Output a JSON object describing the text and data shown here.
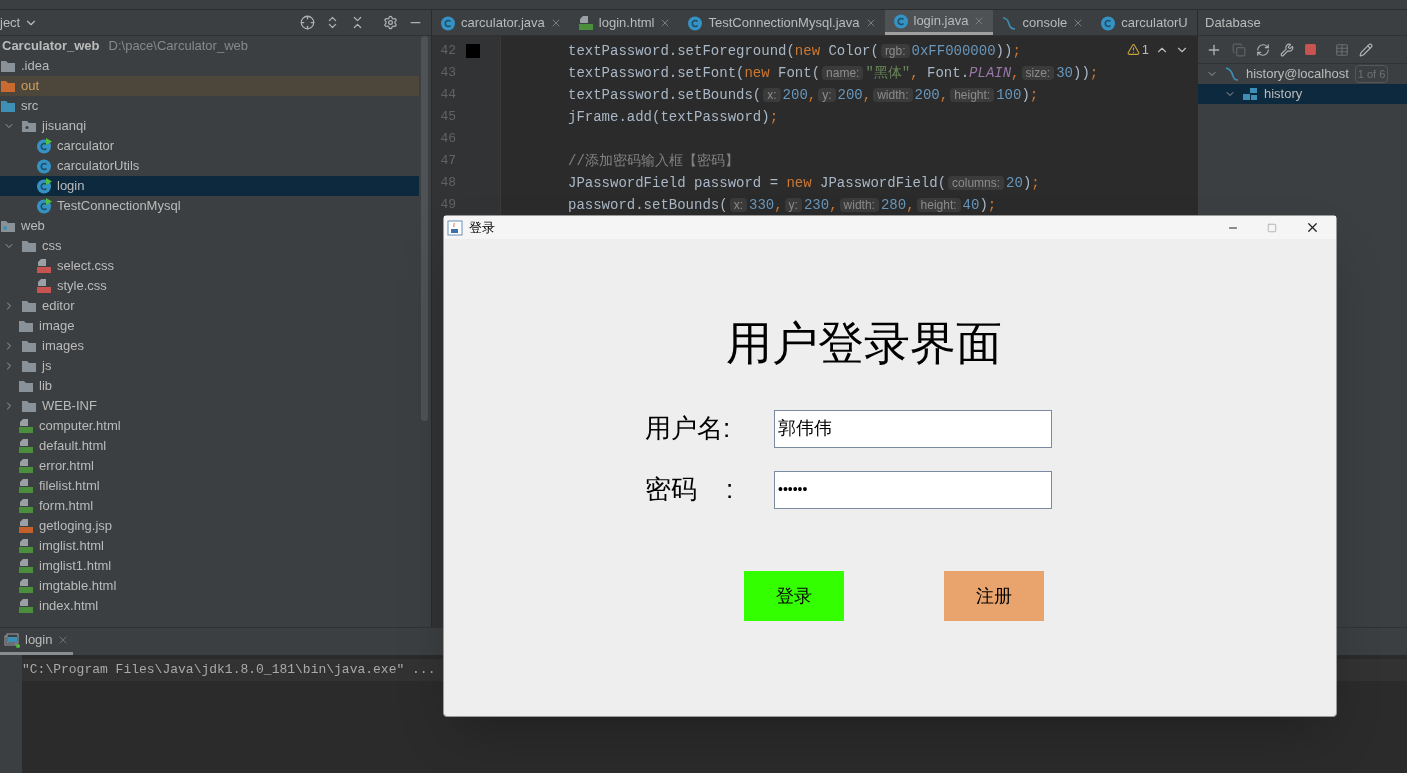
{
  "project_panel": {
    "title": "ject",
    "tree": [
      {
        "name": "Carculator_web",
        "path": "D:\\pace\\Carculator_web",
        "selected": false,
        "children": [
          {
            "name": ".idea",
            "kind": "folder",
            "selected": false
          },
          {
            "name": "out",
            "kind": "excluded",
            "selected": false
          },
          {
            "name": "src",
            "kind": "source",
            "selected": false,
            "children": [
              {
                "name": "jisuanqi",
                "kind": "package",
                "expanded": true,
                "selected": false,
                "children": [
                  {
                    "name": "carculator",
                    "kind": "class-run",
                    "selected": false
                  },
                  {
                    "name": "carculatorUtils",
                    "kind": "class",
                    "selected": false
                  },
                  {
                    "name": "login",
                    "kind": "class-run",
                    "selected": true
                  },
                  {
                    "name": "TestConnectionMysql",
                    "kind": "class-run",
                    "selected": false
                  }
                ]
              }
            ]
          },
          {
            "name": "web",
            "kind": "web",
            "selected": false,
            "children": [
              {
                "name": "css",
                "kind": "folder",
                "expanded": true,
                "selected": false,
                "children": [
                  {
                    "name": "select.css",
                    "kind": "css",
                    "selected": false
                  },
                  {
                    "name": "style.css",
                    "kind": "css",
                    "selected": false
                  }
                ]
              },
              {
                "name": "editor",
                "kind": "folder",
                "expanded": false,
                "selected": false
              },
              {
                "name": "image",
                "kind": "folder",
                "selected": false
              },
              {
                "name": "images",
                "kind": "folder",
                "expanded": false,
                "selected": false
              },
              {
                "name": "js",
                "kind": "folder",
                "expanded": false,
                "selected": false
              },
              {
                "name": "lib",
                "kind": "folder",
                "selected": false
              },
              {
                "name": "WEB-INF",
                "kind": "folder",
                "expanded": false,
                "selected": false
              },
              {
                "name": "computer.html",
                "kind": "html",
                "selected": false
              },
              {
                "name": "default.html",
                "kind": "html",
                "selected": false
              },
              {
                "name": "error.html",
                "kind": "html",
                "selected": false
              },
              {
                "name": "filelist.html",
                "kind": "html",
                "selected": false
              },
              {
                "name": "form.html",
                "kind": "html",
                "selected": false
              },
              {
                "name": "getloging.jsp",
                "kind": "jsp",
                "selected": false
              },
              {
                "name": "imglist.html",
                "kind": "html",
                "selected": false
              },
              {
                "name": "imglist1.html",
                "kind": "html",
                "selected": false
              },
              {
                "name": "imgtable.html",
                "kind": "html",
                "selected": false
              },
              {
                "name": "index.html",
                "kind": "html",
                "selected": false
              }
            ]
          }
        ]
      }
    ]
  },
  "editor": {
    "tabs": [
      {
        "label": "carculator.java",
        "kind": "class",
        "selected": false,
        "closable": true
      },
      {
        "label": "login.html",
        "kind": "html",
        "selected": false,
        "closable": true
      },
      {
        "label": "TestConnectionMysql.java",
        "kind": "class",
        "selected": false,
        "closable": true
      },
      {
        "label": "login.java",
        "kind": "class",
        "selected": true,
        "closable": true
      },
      {
        "label": "console",
        "kind": "console",
        "selected": false,
        "closable": true
      },
      {
        "label": "carculatorU",
        "kind": "class",
        "selected": false,
        "closable": false
      }
    ],
    "warnings": "1",
    "lines": [
      {
        "number": "42",
        "color": "#000000",
        "tokens": [
          {
            "kind": "code",
            "text": "textPassword.setForeground("
          },
          {
            "kind": "kw",
            "text": "new"
          },
          {
            "kind": "code",
            "text": " Color("
          },
          {
            "kind": "hint",
            "text": "rgb:"
          },
          {
            "kind": "num",
            "text": "0xFF000000"
          },
          {
            "kind": "code",
            "text": "))"
          },
          {
            "kind": "kw",
            "text": ";"
          }
        ]
      },
      {
        "number": "43",
        "tokens": [
          {
            "kind": "code",
            "text": "textPassword.setFont("
          },
          {
            "kind": "kw",
            "text": "new"
          },
          {
            "kind": "code",
            "text": " Font("
          },
          {
            "kind": "hint",
            "text": "name:"
          },
          {
            "kind": "str",
            "text": "\"黑体\""
          },
          {
            "kind": "kw",
            "text": ", "
          },
          {
            "kind": "code",
            "text": "Font."
          },
          {
            "kind": "const",
            "text": "PLAIN"
          },
          {
            "kind": "kw",
            "text": ","
          },
          {
            "kind": "hint",
            "text": "size:"
          },
          {
            "kind": "num",
            "text": "30"
          },
          {
            "kind": "code",
            "text": "))"
          },
          {
            "kind": "kw",
            "text": ";"
          }
        ]
      },
      {
        "number": "44",
        "tokens": [
          {
            "kind": "code",
            "text": "textPassword.setBounds("
          },
          {
            "kind": "hint",
            "text": "x:"
          },
          {
            "kind": "num",
            "text": "200"
          },
          {
            "kind": "kw",
            "text": ","
          },
          {
            "kind": "hint",
            "text": "y:"
          },
          {
            "kind": "num",
            "text": "200"
          },
          {
            "kind": "kw",
            "text": ","
          },
          {
            "kind": "hint",
            "text": "width:"
          },
          {
            "kind": "num",
            "text": "200"
          },
          {
            "kind": "kw",
            "text": ","
          },
          {
            "kind": "hint",
            "text": "height:"
          },
          {
            "kind": "num",
            "text": "100"
          },
          {
            "kind": "code",
            "text": ")"
          },
          {
            "kind": "kw",
            "text": ";"
          }
        ]
      },
      {
        "number": "45",
        "tokens": [
          {
            "kind": "code",
            "text": "jFrame.add(textPassword)"
          },
          {
            "kind": "kw",
            "text": ";"
          }
        ]
      },
      {
        "number": "46"
      },
      {
        "number": "47",
        "tokens": [
          {
            "kind": "comment",
            "text": "//添加密码输入框【密码】"
          }
        ]
      },
      {
        "number": "48",
        "tokens": [
          {
            "kind": "code",
            "text": "JPasswordField password = "
          },
          {
            "kind": "kw",
            "text": "new"
          },
          {
            "kind": "code",
            "text": " JPasswordField("
          },
          {
            "kind": "hint",
            "text": "columns:"
          },
          {
            "kind": "num",
            "text": "20"
          },
          {
            "kind": "code",
            "text": ")"
          },
          {
            "kind": "kw",
            "text": ";"
          }
        ]
      },
      {
        "number": "49",
        "tokens": [
          {
            "kind": "code",
            "text": "password.setBounds("
          },
          {
            "kind": "hint",
            "text": "x:"
          },
          {
            "kind": "num",
            "text": "330"
          },
          {
            "kind": "kw",
            "text": ","
          },
          {
            "kind": "hint",
            "text": "y:"
          },
          {
            "kind": "num",
            "text": "230"
          },
          {
            "kind": "kw",
            "text": ","
          },
          {
            "kind": "hint",
            "text": "width:"
          },
          {
            "kind": "num",
            "text": "280"
          },
          {
            "kind": "kw",
            "text": ","
          },
          {
            "kind": "hint",
            "text": "height:"
          },
          {
            "kind": "num",
            "text": "40"
          },
          {
            "kind": "code",
            "text": ")"
          },
          {
            "kind": "kw",
            "text": ";"
          }
        ]
      }
    ]
  },
  "database_panel": {
    "title": "Database",
    "tree": [
      {
        "name": "history@localhost",
        "badge": "1 of 6",
        "expanded": true,
        "selected": false,
        "children": [
          {
            "name": "history",
            "expanded": true,
            "selected": true
          }
        ]
      }
    ]
  },
  "run_panel": {
    "tab": "login",
    "output": "\"C:\\Program Files\\Java\\jdk1.8.0_181\\bin\\java.exe\" ..."
  },
  "dialog": {
    "title": "登录",
    "heading": "用户登录界面",
    "fields": [
      {
        "label": "用户名:",
        "kind": "text",
        "value": "郭伟伟"
      },
      {
        "label": "密码    :",
        "kind": "password",
        "value": "••••••"
      }
    ],
    "buttons": [
      {
        "label": "登录",
        "color": "#33ff00"
      },
      {
        "label": "注册",
        "color": "#e8a46c"
      }
    ]
  }
}
